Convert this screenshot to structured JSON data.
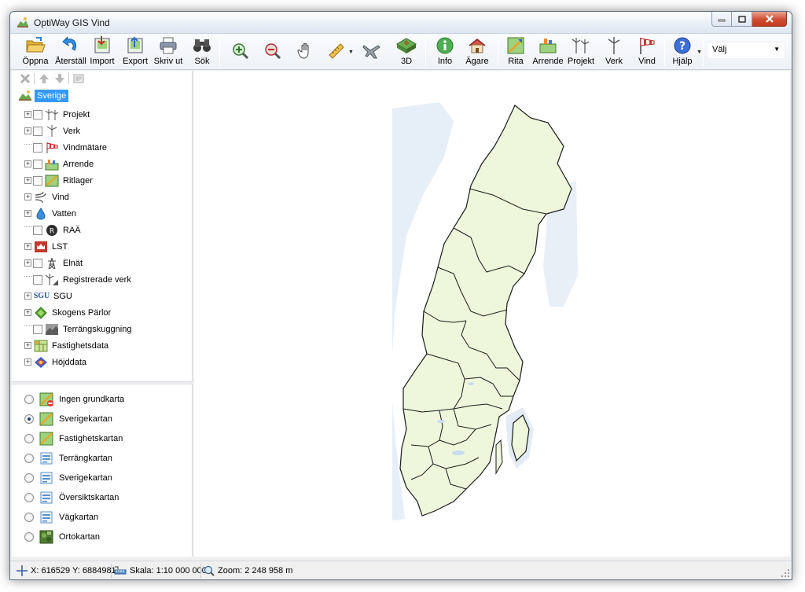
{
  "window": {
    "title": "OptiWay GIS Vind"
  },
  "toolbar": {
    "open": "Öppna",
    "reset": "Återställ",
    "import": "Import",
    "export": "Export",
    "print": "Skriv ut",
    "search": "Sök",
    "view3d": "3D",
    "info": "Info",
    "owner": "Ägare",
    "draw": "Rita",
    "lease": "Arrende",
    "project": "Projekt",
    "turbine": "Verk",
    "wind": "Vind",
    "help": "Hjälp",
    "choose": "Välj"
  },
  "tree": {
    "root": "Sverige",
    "layers": [
      {
        "label": "Projekt"
      },
      {
        "label": "Verk"
      },
      {
        "label": "Vindmätare"
      },
      {
        "label": "Arrende"
      },
      {
        "label": "Ritlager"
      },
      {
        "label": "Vind"
      },
      {
        "label": "Vatten"
      },
      {
        "label": "RAÄ"
      },
      {
        "label": "LST"
      },
      {
        "label": "Elnät"
      },
      {
        "label": "Registrerade verk"
      },
      {
        "label": "SGU",
        "icon_text": "SGU"
      },
      {
        "label": "Skogens Pärlor"
      },
      {
        "label": "Terrängskuggning"
      },
      {
        "label": "Fastighetsdata"
      },
      {
        "label": "Höjddata"
      }
    ]
  },
  "basemaps": {
    "selected": "Sverigekartan",
    "items": [
      {
        "label": "Ingen grundkarta"
      },
      {
        "label": "Sverigekartan"
      },
      {
        "label": "Fastighetskartan"
      },
      {
        "label": "Terrängkartan"
      },
      {
        "label": "Sverigekartan"
      },
      {
        "label": "Översiktskartan"
      },
      {
        "label": "Vägkartan"
      },
      {
        "label": "Ortokartan"
      }
    ]
  },
  "status": {
    "coords": "X: 616529 Y: 6884981",
    "scale": "Skala: 1:10 000 000",
    "zoom": "Zoom: 2 248 958 m"
  },
  "colors": {
    "land": "#eef7dc",
    "water": "#dde9f5",
    "border": "#1a1a1a",
    "selection": "#3399ff"
  }
}
